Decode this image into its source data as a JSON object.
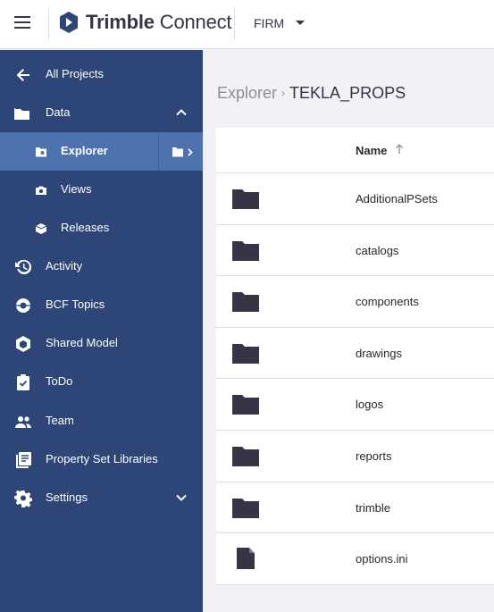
{
  "header": {
    "brand_bold": "Trimble",
    "brand_light": " Connect",
    "org": "FIRM"
  },
  "sidebar": {
    "items": [
      {
        "label": "All Projects",
        "icon": "arrow-left-icon"
      },
      {
        "label": "Data",
        "icon": "folder-icon",
        "expanded": true
      },
      {
        "label": "Explorer",
        "icon": "explorer-icon",
        "active": true
      },
      {
        "label": "Views",
        "icon": "camera-icon"
      },
      {
        "label": "Releases",
        "icon": "release-icon"
      },
      {
        "label": "Activity",
        "icon": "history-icon"
      },
      {
        "label": "BCF Topics",
        "icon": "bcf-icon"
      },
      {
        "label": "Shared Model",
        "icon": "shared-model-icon"
      },
      {
        "label": "ToDo",
        "icon": "todo-icon"
      },
      {
        "label": "Team",
        "icon": "team-icon"
      },
      {
        "label": "Property Set Libraries",
        "icon": "library-icon"
      },
      {
        "label": "Settings",
        "icon": "gear-icon",
        "expanded": false
      }
    ]
  },
  "breadcrumb": {
    "root": "Explorer",
    "current": "TEKLA_PROPS"
  },
  "table": {
    "column_name": "Name",
    "sort": "ascending",
    "rows": [
      {
        "name": "AdditionalPSets",
        "type": "folder"
      },
      {
        "name": "catalogs",
        "type": "folder"
      },
      {
        "name": "components",
        "type": "folder"
      },
      {
        "name": "drawings",
        "type": "folder"
      },
      {
        "name": "logos",
        "type": "folder"
      },
      {
        "name": "reports",
        "type": "folder"
      },
      {
        "name": "trimble",
        "type": "folder"
      },
      {
        "name": "options.ini",
        "type": "file"
      }
    ]
  },
  "colors": {
    "sidebar_bg": "#2d4677",
    "active_bg": "#4d72b0",
    "icon_dark": "#363545"
  }
}
